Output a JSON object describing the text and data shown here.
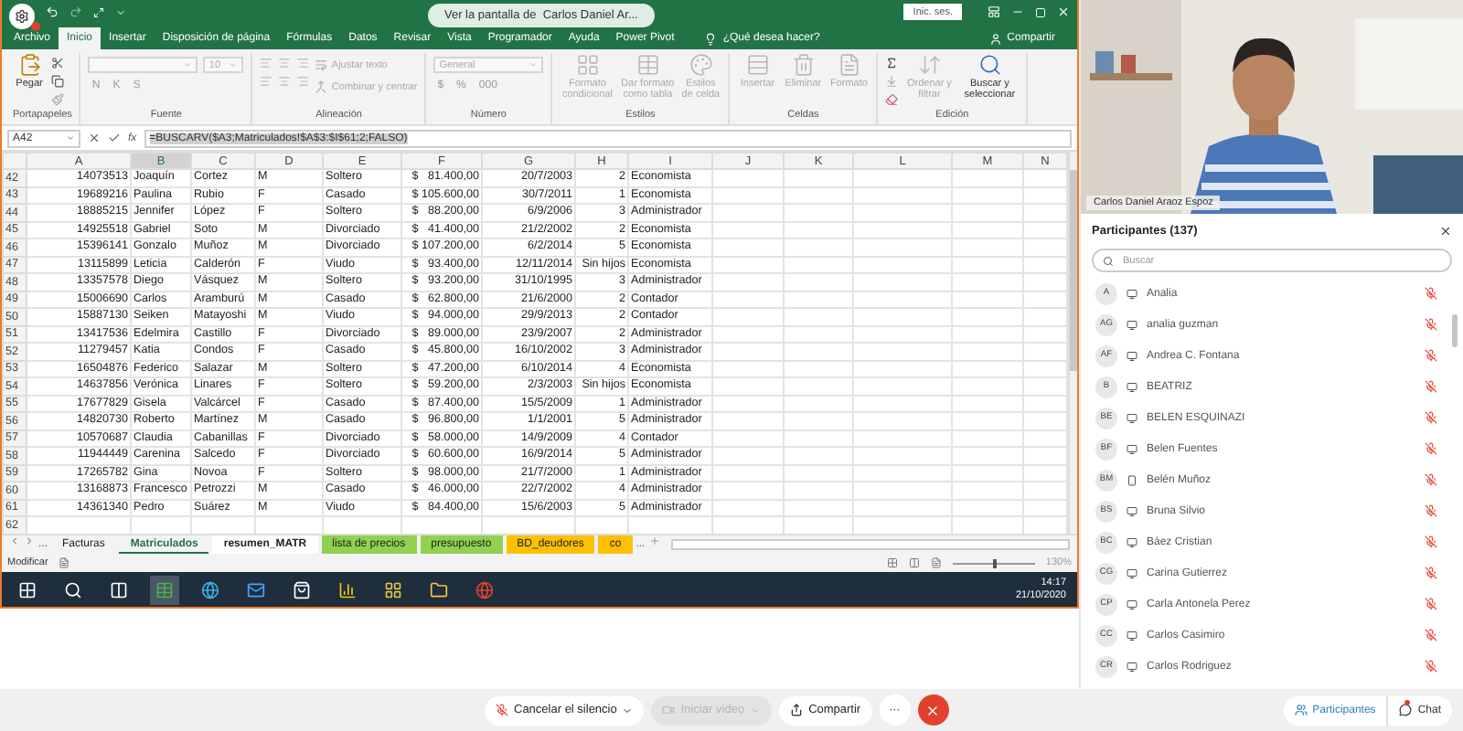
{
  "share_banner": "Ver la pantalla de  Carlos Daniel Ar...",
  "excel": {
    "sign_in": "Inic. ses.",
    "ribbon_tabs": [
      {
        "label": "Archivo",
        "selected": false
      },
      {
        "label": "Inicio",
        "selected": true
      },
      {
        "label": "Insertar",
        "selected": false
      },
      {
        "label": "Disposición de página",
        "selected": false
      },
      {
        "label": "Fórmulas",
        "selected": false
      },
      {
        "label": "Datos",
        "selected": false
      },
      {
        "label": "Revisar",
        "selected": false
      },
      {
        "label": "Vista",
        "selected": false
      },
      {
        "label": "Programador",
        "selected": false
      },
      {
        "label": "Ayuda",
        "selected": false
      },
      {
        "label": "Power Pivot",
        "selected": false
      }
    ],
    "tell_me": "¿Qué desea hacer?",
    "share": "Compartir",
    "ribbon_groups": [
      {
        "label": "Portapapeles",
        "large": [
          {
            "label": "Pegar",
            "disabled": false
          }
        ]
      },
      {
        "label": "Fuente",
        "rows": [
          [
            {
              "kind": "field",
              "disabled": true
            },
            {
              "kind": "field",
              "value": "10",
              "disabled": true
            }
          ],
          [
            {
              "kind": "glyph",
              "value": "N",
              "disabled": true
            },
            {
              "kind": "glyph",
              "value": "K",
              "disabled": true
            },
            {
              "kind": "glyph",
              "value": "S",
              "disabled": true
            }
          ]
        ]
      },
      {
        "label": "Alineación",
        "rows": [
          [
            {
              "kind": "inline",
              "value": "Ajustar texto",
              "disabled": true
            }
          ],
          [
            {
              "kind": "inline",
              "value": "Combinar y centrar",
              "disabled": true
            }
          ]
        ]
      },
      {
        "label": "Número",
        "rows": [
          [
            {
              "kind": "field",
              "value": "General",
              "disabled": true
            }
          ],
          [
            {
              "kind": "glyph",
              "value": "$",
              "disabled": true
            },
            {
              "kind": "glyph",
              "value": "%",
              "disabled": true
            },
            {
              "kind": "glyph",
              "value": "000",
              "disabled": true
            }
          ]
        ]
      },
      {
        "label": "Estilos",
        "large": [
          {
            "label": "Formato condicional",
            "disabled": true
          },
          {
            "label": "Dar formato como tabla",
            "disabled": true
          },
          {
            "label": "Estilos de celda",
            "disabled": true
          }
        ]
      },
      {
        "label": "Celdas",
        "large": [
          {
            "label": "Insertar",
            "disabled": true
          },
          {
            "label": "Eliminar",
            "disabled": true
          },
          {
            "label": "Formato",
            "disabled": true
          }
        ]
      },
      {
        "label": "Edición",
        "large": [
          {
            "label": "Ordenar y filtrar",
            "disabled": true
          },
          {
            "label": "Buscar y seleccionar",
            "disabled": false
          }
        ]
      }
    ],
    "name_box": "A42",
    "function_label": "fx",
    "formula": "=BUSCARV($A3;Matriculados!$A$3:$I$61;2;FALSO)",
    "columns": [
      {
        "label": "A",
        "selected": false
      },
      {
        "label": "B",
        "selected": true
      },
      {
        "label": "C",
        "selected": false
      },
      {
        "label": "D",
        "selected": false
      },
      {
        "label": "E",
        "selected": false
      },
      {
        "label": "F",
        "selected": false
      },
      {
        "label": "G",
        "selected": false
      },
      {
        "label": "H",
        "selected": false
      },
      {
        "label": "I",
        "selected": false
      },
      {
        "label": "J",
        "selected": false
      },
      {
        "label": "K",
        "selected": false
      },
      {
        "label": "L",
        "selected": false
      },
      {
        "label": "M",
        "selected": false
      },
      {
        "label": "N",
        "selected": false
      }
    ],
    "rows": [
      {
        "number": "42",
        "cells": [
          "14073513",
          "Joaquín",
          "Cortez",
          "M",
          "Soltero",
          "$   81.400,00",
          "20/7/2003",
          "2",
          "Economista"
        ]
      },
      {
        "number": "43",
        "cells": [
          "19689216",
          "Paulina",
          "Rubio",
          "F",
          "Casado",
          "$ 105.600,00",
          "30/7/2011",
          "1",
          "Economista"
        ]
      },
      {
        "number": "44",
        "cells": [
          "18885215",
          "Jennifer",
          "López",
          "F",
          "Soltero",
          "$   88.200,00",
          "6/9/2006",
          "3",
          "Administrador"
        ]
      },
      {
        "number": "45",
        "cells": [
          "14925518",
          "Gabriel",
          "Soto",
          "M",
          "Divorciado",
          "$   41.400,00",
          "21/2/2002",
          "2",
          "Economista"
        ]
      },
      {
        "number": "46",
        "cells": [
          "15396141",
          "Gonzalo",
          "Muñoz",
          "M",
          "Divorciado",
          "$ 107.200,00",
          "6/2/2014",
          "5",
          "Economista"
        ]
      },
      {
        "number": "47",
        "cells": [
          "13115899",
          "Leticia",
          "Calderón",
          "F",
          "Viudo",
          "$   93.400,00",
          "12/11/2014",
          "Sin hijos",
          "Economista"
        ]
      },
      {
        "number": "48",
        "cells": [
          "13357578",
          "Diego",
          "Vásquez",
          "M",
          "Soltero",
          "$   93.200,00",
          "31/10/1995",
          "3",
          "Administrador"
        ]
      },
      {
        "number": "49",
        "cells": [
          "15006690",
          "Carlos",
          "Aramburú",
          "M",
          "Casado",
          "$   62.800,00",
          "21/6/2000",
          "2",
          "Contador"
        ]
      },
      {
        "number": "50",
        "cells": [
          "15887130",
          "Seiken",
          "Matayoshi",
          "M",
          "Viudo",
          "$   94.000,00",
          "29/9/2013",
          "2",
          "Contador"
        ]
      },
      {
        "number": "51",
        "cells": [
          "13417536",
          "Edelmira",
          "Castillo",
          "F",
          "Divorciado",
          "$   89.000,00",
          "23/9/2007",
          "2",
          "Administrador"
        ]
      },
      {
        "number": "52",
        "cells": [
          "11279457",
          "Katia",
          "Condos",
          "F",
          "Casado",
          "$   45.800,00",
          "16/10/2002",
          "3",
          "Administrador"
        ]
      },
      {
        "number": "53",
        "cells": [
          "16504876",
          "Federico",
          "Salazar",
          "M",
          "Soltero",
          "$   47.200,00",
          "6/10/2014",
          "4",
          "Economista"
        ]
      },
      {
        "number": "54",
        "cells": [
          "14637856",
          "Verónica",
          "Linares",
          "F",
          "Soltero",
          "$   59.200,00",
          "2/3/2003",
          "Sin hijos",
          "Economista"
        ]
      },
      {
        "number": "55",
        "cells": [
          "17677829",
          "Gisela",
          "Valcárcel",
          "F",
          "Casado",
          "$   87.400,00",
          "15/5/2009",
          "1",
          "Administrador"
        ]
      },
      {
        "number": "56",
        "cells": [
          "14820730",
          "Roberto",
          "Martínez",
          "M",
          "Casado",
          "$   96.800,00",
          "1/1/2001",
          "5",
          "Administrador"
        ]
      },
      {
        "number": "57",
        "cells": [
          "10570687",
          "Claudia",
          "Cabanillas",
          "F",
          "Divorciado",
          "$   58.000,00",
          "14/9/2009",
          "4",
          "Contador"
        ]
      },
      {
        "number": "58",
        "cells": [
          "11944449",
          "Carenina",
          "Salcedo",
          "F",
          "Divorciado",
          "$   60.600,00",
          "16/9/2014",
          "5",
          "Administrador"
        ]
      },
      {
        "number": "59",
        "cells": [
          "17265782",
          "Gina",
          "Novoa",
          "F",
          "Soltero",
          "$   98.000,00",
          "21/7/2000",
          "1",
          "Administrador"
        ]
      },
      {
        "number": "60",
        "cells": [
          "13168873",
          "Francesco",
          "Petrozzi",
          "M",
          "Casado",
          "$   46.000,00",
          "22/7/2002",
          "4",
          "Administrador"
        ]
      },
      {
        "number": "61",
        "cells": [
          "14361340",
          "Pedro",
          "Suárez",
          "M",
          "Viudo",
          "$   84.400,00",
          "15/6/2003",
          "5",
          "Administrador"
        ]
      },
      {
        "number": "62",
        "cells": []
      }
    ],
    "sheet_tabs": [
      {
        "label": "Facturas",
        "selected": false
      },
      {
        "label": "Matriculados",
        "selected": true
      },
      {
        "label": "resumen_MATR",
        "selected": false,
        "color": "#ffffff"
      },
      {
        "label": "lista de precios",
        "selected": false,
        "color": "#92d050"
      },
      {
        "label": "presupuesto",
        "selected": false,
        "color": "#92d050"
      },
      {
        "label": "BD_deudores",
        "selected": false,
        "color": "#ffc000"
      },
      {
        "label": "co",
        "selected": false,
        "color": "#ffc000"
      }
    ],
    "more_tabs": "...",
    "status": "Modificar",
    "zoom": {
      "level": 0.5,
      "label": "130%"
    },
    "clock": {
      "time": "14:17",
      "date": "21/10/2020"
    }
  },
  "video": {
    "name": "Carlos Daniel Araoz Espoz"
  },
  "participants": {
    "title": "Participantes (137)",
    "search_placeholder": "Buscar",
    "items": [
      {
        "initials": "A",
        "name": "Analia",
        "mobile": false,
        "muted": true
      },
      {
        "initials": "AG",
        "name": "analia guzman",
        "mobile": false,
        "muted": true
      },
      {
        "initials": "AF",
        "name": "Andrea C. Fontana",
        "mobile": false,
        "muted": true
      },
      {
        "initials": "B",
        "name": "BEATRIZ",
        "mobile": false,
        "muted": true
      },
      {
        "initials": "BE",
        "name": "BELEN ESQUINAZI",
        "mobile": false,
        "muted": true
      },
      {
        "initials": "BF",
        "name": "Belen Fuentes",
        "mobile": false,
        "muted": true
      },
      {
        "initials": "BM",
        "name": "Belén Muñoz",
        "mobile": true,
        "muted": true
      },
      {
        "initials": "BS",
        "name": "Bruna Silvio",
        "mobile": false,
        "muted": true
      },
      {
        "initials": "BC",
        "name": "Báez Cristian",
        "mobile": false,
        "muted": true
      },
      {
        "initials": "CG",
        "name": "Carina Gutierrez",
        "mobile": false,
        "muted": true
      },
      {
        "initials": "CP",
        "name": "Carla Antonela Perez",
        "mobile": false,
        "muted": true
      },
      {
        "initials": "CC",
        "name": "Carlos Casimiro",
        "mobile": false,
        "muted": true
      },
      {
        "initials": "CR",
        "name": "Carlos Rodriguez",
        "mobile": false,
        "muted": true
      }
    ]
  },
  "controls": [
    {
      "kind": "mute",
      "label": "Cancelar el silencio",
      "disabled": false
    },
    {
      "kind": "video",
      "label": "Iniciar video",
      "disabled": true
    },
    {
      "kind": "share",
      "label": "Compartir",
      "disabled": false
    },
    {
      "kind": "more",
      "label": "···"
    },
    {
      "kind": "leave"
    }
  ],
  "panel_buttons": [
    {
      "kind": "participants",
      "label": "Participantes",
      "selected": true
    },
    {
      "kind": "chat",
      "label": "Chat",
      "selected": false,
      "unread": true
    }
  ]
}
